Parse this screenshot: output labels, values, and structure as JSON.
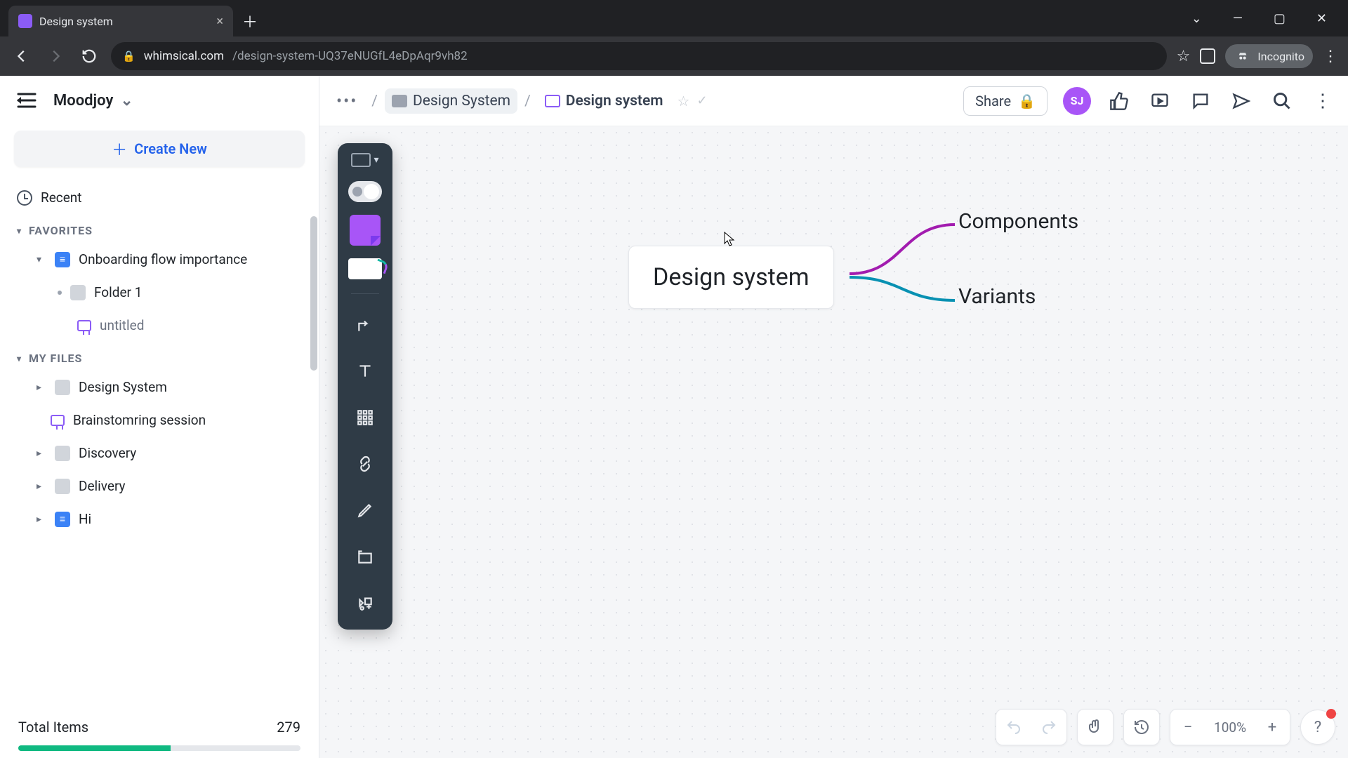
{
  "browser": {
    "tab_title": "Design system",
    "url_domain": "whimsical.com",
    "url_path": "/design-system-UQ37eNUGfL4eDpAqr9vh82",
    "incognito_label": "Incognito"
  },
  "workspace": {
    "name": "Moodjoy"
  },
  "sidebar": {
    "create_label": "Create New",
    "recent_label": "Recent",
    "favorites_header": "FAVORITES",
    "favorites": [
      {
        "label": "Onboarding flow importance",
        "type": "doc"
      },
      {
        "label": "Folder 1",
        "type": "folder"
      },
      {
        "label": "untitled",
        "type": "board"
      }
    ],
    "myfiles_header": "MY FILES",
    "myfiles": [
      {
        "label": "Design System",
        "type": "folder"
      },
      {
        "label": "Brainstomring session",
        "type": "board"
      },
      {
        "label": "Discovery",
        "type": "folder"
      },
      {
        "label": "Delivery",
        "type": "folder"
      },
      {
        "label": "Hi",
        "type": "doc"
      }
    ],
    "footer_label": "Total Items",
    "footer_count": "279"
  },
  "topbar": {
    "crumb_folder": "Design System",
    "crumb_file": "Design system",
    "share_label": "Share",
    "avatar_initials": "SJ"
  },
  "mindmap": {
    "root": "Design system",
    "children": [
      "Components",
      "Variants"
    ],
    "colors": {
      "child1": "#a21caf",
      "child2": "#0891b2"
    }
  },
  "canvas_controls": {
    "zoom": "100%"
  }
}
